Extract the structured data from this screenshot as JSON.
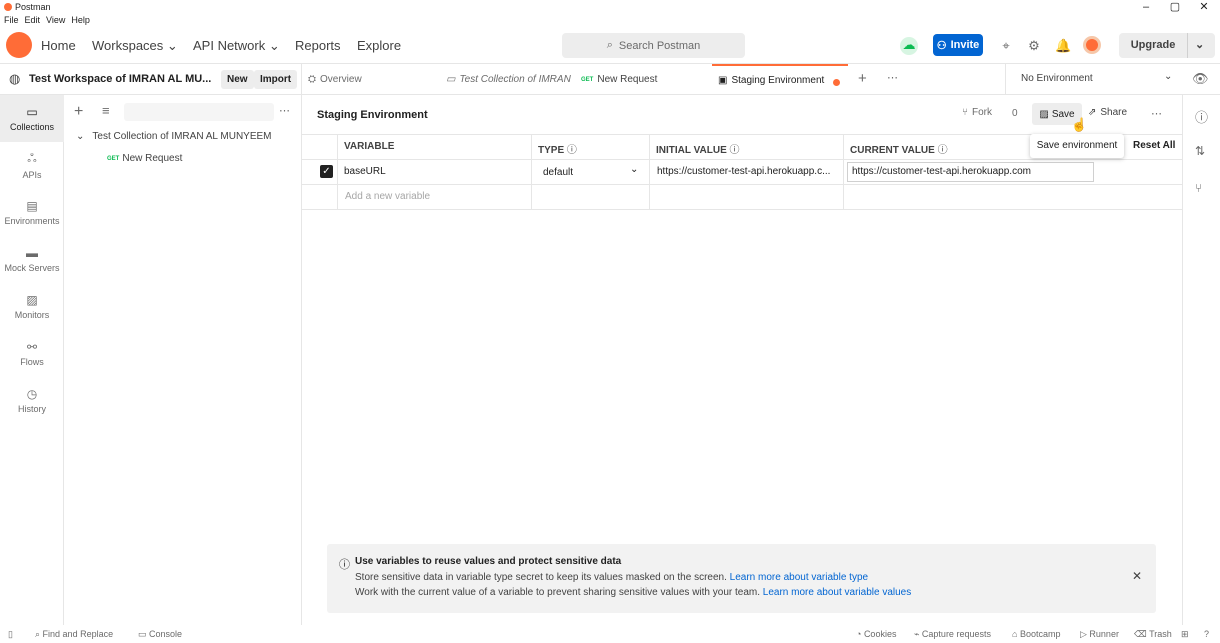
{
  "window": {
    "title": "Postman",
    "menus": [
      "File",
      "Edit",
      "View",
      "Help"
    ],
    "minimize": "–",
    "maximize": "▢",
    "close": "✕"
  },
  "header": {
    "nav": {
      "home": "Home",
      "workspaces": "Workspaces",
      "api_network": "API Network",
      "reports": "Reports",
      "explore": "Explore"
    },
    "search_placeholder": "Search Postman",
    "invite_label": "Invite",
    "upgrade_label": "Upgrade"
  },
  "workspace": {
    "name": "Test Workspace of IMRAN AL MU...",
    "new_label": "New",
    "import_label": "Import"
  },
  "tabs": [
    {
      "label": "Overview"
    },
    {
      "label": "Test Collection of IMRAN"
    },
    {
      "method": "GET",
      "label": "New Request"
    },
    {
      "label": "Staging Environment"
    }
  ],
  "environment_selector": "No Environment",
  "left_nav": [
    "Collections",
    "APIs",
    "Environments",
    "Mock Servers",
    "Monitors",
    "Flows",
    "History"
  ],
  "sidebar": {
    "collection": "Test Collection of IMRAN AL MUNYEEM",
    "request_method": "GET",
    "request_label": "New Request"
  },
  "editor": {
    "title": "Staging Environment",
    "fork_label": "Fork",
    "fork_count": "0",
    "save_label": "Save",
    "share_label": "Share",
    "tooltip": "Save environment",
    "columns": {
      "variable": "VARIABLE",
      "type": "TYPE",
      "initial": "INITIAL VALUE",
      "current": "CURRENT VALUE",
      "reset": "Reset All"
    },
    "rows": [
      {
        "variable": "baseURL",
        "type": "default",
        "initial": "https://customer-test-api.herokuapp.c...",
        "current": "https://customer-test-api.herokuapp.com"
      }
    ],
    "add_placeholder": "Add a new variable"
  },
  "info": {
    "title": "Use variables to reuse values and protect sensitive data",
    "line1": "Store sensitive data in variable type secret to keep its values masked on the screen.",
    "link1": "Learn more about variable type",
    "line2": "Work with the current value of a variable to prevent sharing sensitive values with your team.",
    "link2": "Learn more about variable values"
  },
  "footer": {
    "find": "Find and Replace",
    "console": "Console",
    "cookies": "Cookies",
    "capture": "Capture requests",
    "bootcamp": "Bootcamp",
    "runner": "Runner",
    "trash": "Trash"
  },
  "colors": {
    "brand": "#ff6c37",
    "accent": "#0265d2",
    "success": "#0cbb52"
  }
}
